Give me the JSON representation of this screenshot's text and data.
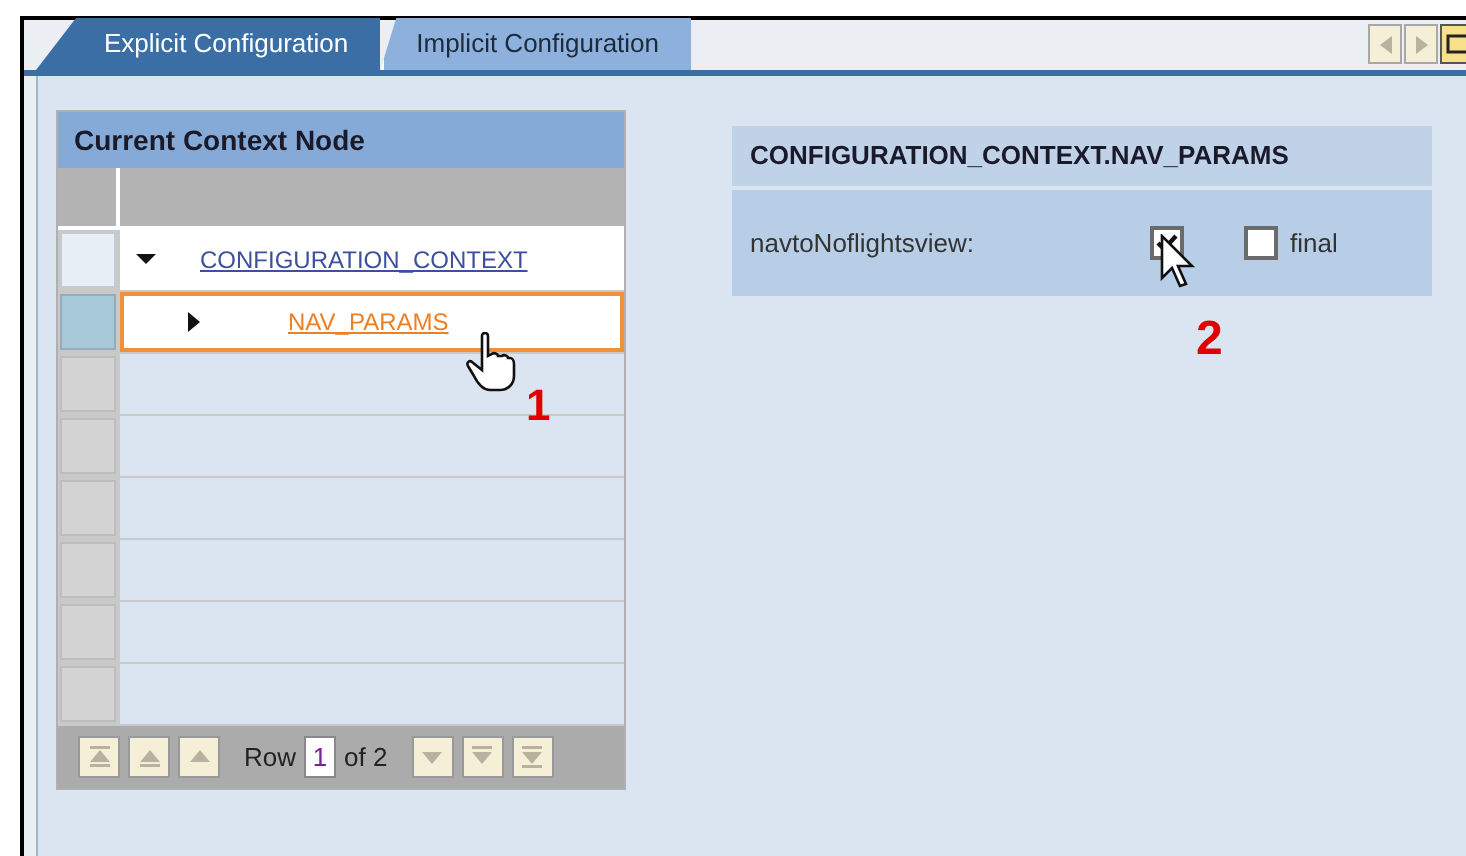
{
  "tabs": [
    {
      "label": "Explicit Configuration",
      "selected": true
    },
    {
      "label": "Implicit Configuration",
      "selected": false
    }
  ],
  "context_panel": {
    "title": "Current Context Node",
    "rows": [
      {
        "kind": "node",
        "label": "CONFIGURATION_CONTEXT",
        "expanded": true,
        "selected": false
      },
      {
        "kind": "node",
        "label": "NAV_PARAMS",
        "expanded": false,
        "selected": true
      },
      {
        "kind": "empty"
      },
      {
        "kind": "empty"
      },
      {
        "kind": "empty"
      },
      {
        "kind": "empty"
      },
      {
        "kind": "empty"
      },
      {
        "kind": "empty"
      }
    ],
    "pager": {
      "label": "Row",
      "value": "1",
      "total": "of 2"
    }
  },
  "attributes_panel": {
    "title": "CONFIGURATION_CONTEXT.NAV_PARAMS",
    "fields": [
      {
        "label": "navtoNoflightsview:",
        "checked": true,
        "final_label": "final",
        "final_checked": false
      }
    ]
  },
  "annotations": [
    "1",
    "2"
  ]
}
